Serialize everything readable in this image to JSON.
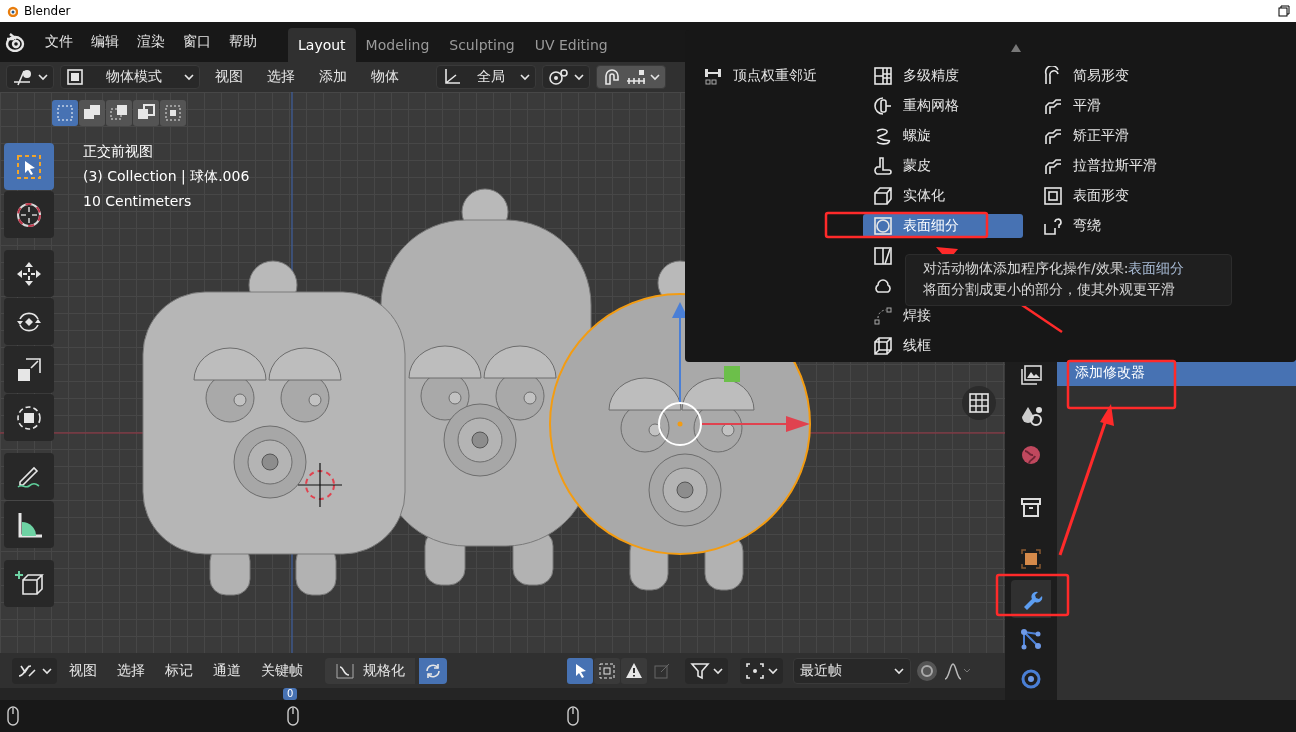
{
  "window": {
    "title": "Blender"
  },
  "menu_bar": {
    "items": [
      "文件",
      "编辑",
      "渲染",
      "窗口",
      "帮助"
    ]
  },
  "workspace_tabs": [
    {
      "label": "Layout",
      "selected": true
    },
    {
      "label": "Modeling",
      "selected": false
    },
    {
      "label": "Sculpting",
      "selected": false
    },
    {
      "label": "UV Editing",
      "selected": false
    }
  ],
  "viewport_header": {
    "mode": "物体模式",
    "menus": [
      "视图",
      "选择",
      "添加",
      "物体"
    ],
    "orientation": "全局",
    "snap": true
  },
  "select_modes": [
    {
      "kind": "new",
      "selected": true
    },
    {
      "kind": "extend",
      "selected": false
    },
    {
      "kind": "subtract",
      "selected": false
    },
    {
      "kind": "invert",
      "selected": false
    },
    {
      "kind": "intersect",
      "selected": false
    }
  ],
  "toolbar": [
    {
      "kind": "select-box",
      "selected": true
    },
    {
      "kind": "cursor",
      "selected": false
    },
    {
      "kind": "move",
      "selected": false
    },
    {
      "kind": "rotate",
      "selected": false
    },
    {
      "kind": "scale",
      "selected": false
    },
    {
      "kind": "transform",
      "selected": false
    },
    {
      "kind": "annotate",
      "selected": false
    },
    {
      "kind": "measure",
      "selected": false
    },
    {
      "kind": "add-cube",
      "selected": false
    }
  ],
  "viewport_overlay": [
    "正交前视图",
    "(3) Collection | 球体.006",
    "10 Centimeters"
  ],
  "modifier_menu": {
    "columns": [
      [
        {
          "kind": "vertex-weight",
          "label": "顶点权重邻近",
          "selected": false
        }
      ],
      [
        {
          "kind": "multires",
          "label": "多级精度",
          "selected": false
        },
        {
          "kind": "remesh",
          "label": "重构网格",
          "selected": false
        },
        {
          "kind": "screw",
          "label": "螺旋",
          "selected": false
        },
        {
          "kind": "skin",
          "label": "蒙皮",
          "selected": false
        },
        {
          "kind": "solidify",
          "label": "实体化",
          "selected": false
        },
        {
          "kind": "subdivision",
          "label": "表面细分",
          "selected": true
        },
        {
          "kind": "triangulate",
          "selected": false
        },
        {
          "kind": "volume",
          "selected": false
        },
        {
          "kind": "weld",
          "label": "焊接",
          "selected": false
        },
        {
          "kind": "wireframe",
          "label": "线框",
          "selected": false
        }
      ],
      [
        {
          "kind": "deform",
          "label": "简易形变",
          "selected": false
        },
        {
          "kind": "smooth",
          "label": "平滑",
          "selected": false
        },
        {
          "kind": "smooth",
          "label": "矫正平滑",
          "selected": false
        },
        {
          "kind": "smooth",
          "label": "拉普拉斯平滑",
          "selected": false
        },
        {
          "kind": "surface-deform",
          "label": "表面形变",
          "selected": false
        },
        {
          "kind": "warp",
          "label": "弯绕",
          "selected": false
        }
      ]
    ]
  },
  "tooltip": {
    "text": "对活动物体添加程序化操作/效果:",
    "modifier_name": "表面细分",
    "description": "将面分割成更小的部分，使其外观更平滑"
  },
  "properties": {
    "tabs": [
      {
        "kind": "view-layer",
        "selected": false
      },
      {
        "kind": "scene",
        "selected": false
      },
      {
        "kind": "world",
        "selected": false
      },
      {
        "kind": "collection",
        "selected": false
      },
      {
        "kind": "object",
        "selected": false
      },
      {
        "kind": "modifier",
        "selected": true
      },
      {
        "kind": "particles",
        "selected": false
      },
      {
        "kind": "physics",
        "selected": false
      }
    ],
    "add_modifier": "添加修改器"
  },
  "timeline_header": {
    "menus": [
      "视图",
      "选择",
      "标记",
      "通道",
      "关键帧"
    ],
    "normalize": "规格化",
    "sync": true,
    "tools": [
      {
        "kind": "select-arrow",
        "on": true
      },
      {
        "kind": "box-select",
        "on": false
      },
      {
        "kind": "warning",
        "on": false
      }
    ],
    "interpolation": "最近帧"
  },
  "timeline": {
    "current_frame": "0"
  }
}
